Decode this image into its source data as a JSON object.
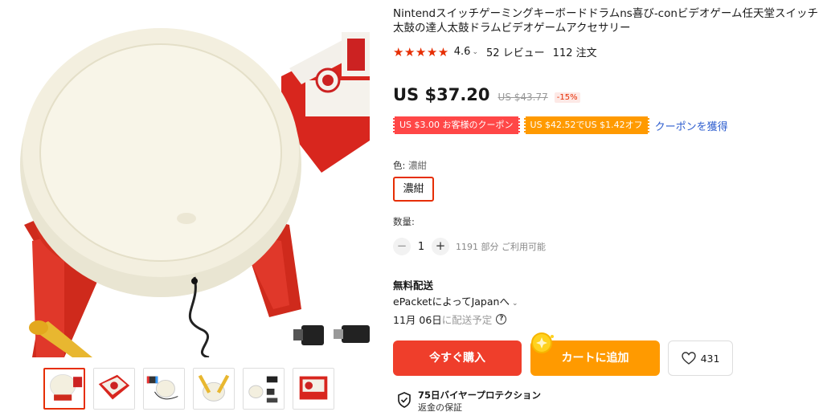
{
  "product": {
    "title": "Nintendスイッチゲーミングキーボードドラムns喜び-conビデオゲーム任天堂スイッチ太鼓の達人太鼓ドラムビデオゲームアクセサリー",
    "stars": "★★★★★",
    "rating": "4.6",
    "rating_caret": "⌄",
    "reviews": "52 レビュー",
    "orders": "112 注文"
  },
  "price": {
    "current": "US $37.20",
    "original": "US $43.77",
    "discount": "-15%"
  },
  "coupons": {
    "red": "US $3.00 お客様のクーポン",
    "orange": "US $42.52でUS $1.42オフ",
    "get_link": "クーポンを獲得"
  },
  "variant": {
    "label": "色: ",
    "selected": "濃紺",
    "chip": "濃紺"
  },
  "quantity": {
    "label": "数量:",
    "minus": "−",
    "value": "1",
    "plus": "+",
    "available": "1191 部分 ご利用可能"
  },
  "shipping": {
    "title": "無料配送",
    "method": "ePacketによってJapanへ",
    "method_chevron": "⌄",
    "date": "11月 06日",
    "date_suffix": "に配送予定",
    "help": "?"
  },
  "actions": {
    "buy_now": "今すぐ購入",
    "add_to_cart": "カートに追加",
    "wishlist_count": "431"
  },
  "protection": {
    "title": "75日バイヤープロテクション",
    "subtitle": "返金の保証"
  },
  "colors": {
    "accent": "#e62e04",
    "buy_button": "#ef3e2b",
    "cart_button": "#ff9a00",
    "coupon_red": "#ff4747",
    "link": "#2e5ecf"
  },
  "gallery": {
    "thumbnail_count": 6,
    "active_index": 0
  }
}
